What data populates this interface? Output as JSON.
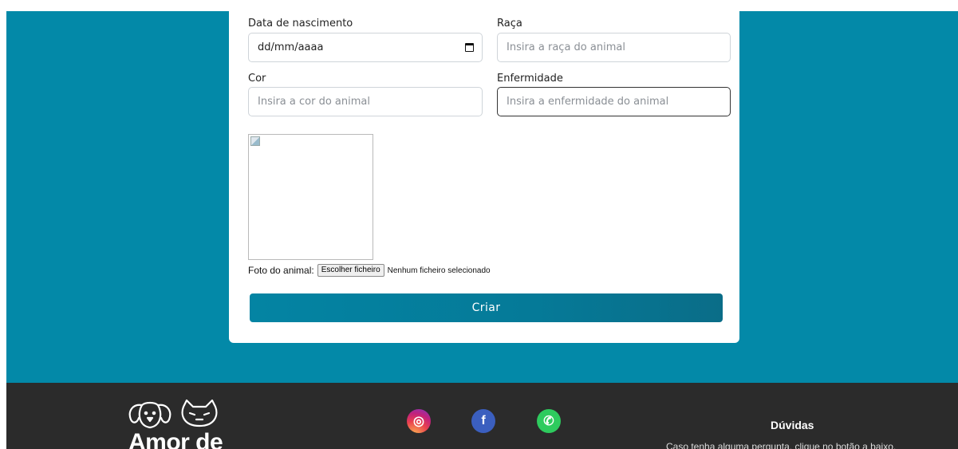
{
  "form": {
    "birth_date": {
      "label": "Data de nascimento",
      "value": "dd/mm/aaaa"
    },
    "breed": {
      "label": "Raça",
      "placeholder": "Insira a raça do animal"
    },
    "color": {
      "label": "Cor",
      "placeholder": "Insira a cor do animal"
    },
    "illness": {
      "label": "Enfermidade",
      "placeholder": "Insira a enfermidade do animal"
    },
    "photo": {
      "label": "Foto do animal:",
      "button_label": "Escolher ficheiro",
      "status": "Nenhum ficheiro selecionado"
    },
    "submit_label": "Criar"
  },
  "footer": {
    "logo_text": "Amor de",
    "social": [
      {
        "name": "instagram",
        "icon": "instagram-icon",
        "glyph": "◎"
      },
      {
        "name": "facebook",
        "icon": "facebook-icon",
        "glyph": "f"
      },
      {
        "name": "whatsapp",
        "icon": "whatsapp-icon",
        "glyph": "✆"
      }
    ],
    "help_title": "Dúvidas",
    "help_text": "Caso tenha alguma pergunta, clique no botão a baixo."
  },
  "colors": {
    "page_background": "#0389a8",
    "button": "#057a98",
    "footer": "#2b2b2b"
  }
}
